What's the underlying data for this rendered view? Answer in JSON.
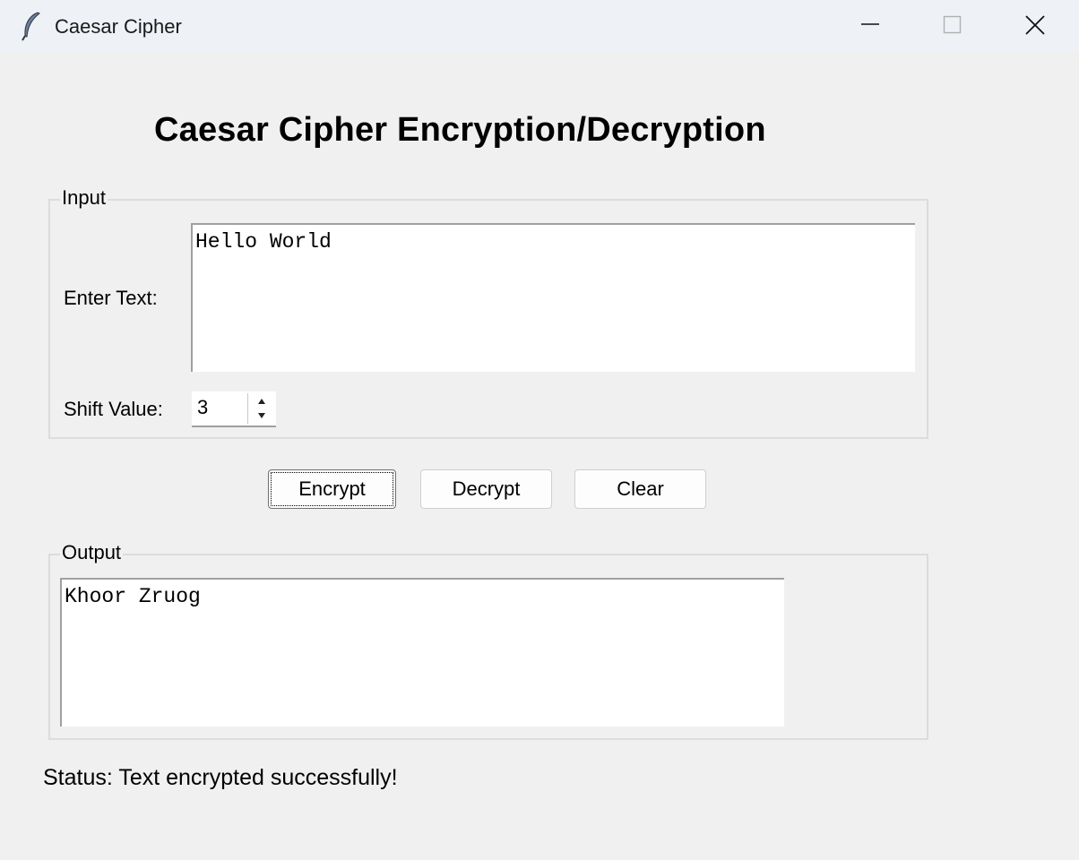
{
  "window": {
    "title": "Caesar Cipher",
    "controls": [
      "minimize-icon",
      "maximize-icon",
      "close-icon"
    ]
  },
  "heading": "Caesar Cipher Encryption/Decryption",
  "input_group": {
    "legend": "Input",
    "text_label": "Enter Text:",
    "text_value": "Hello World",
    "shift_label": "Shift Value:",
    "shift_value": "3"
  },
  "buttons": {
    "encrypt": "Encrypt",
    "decrypt": "Decrypt",
    "clear": "Clear"
  },
  "output_group": {
    "legend": "Output",
    "text_value": "Khoor Zruog"
  },
  "status": "Status: Text encrypted successfully!"
}
